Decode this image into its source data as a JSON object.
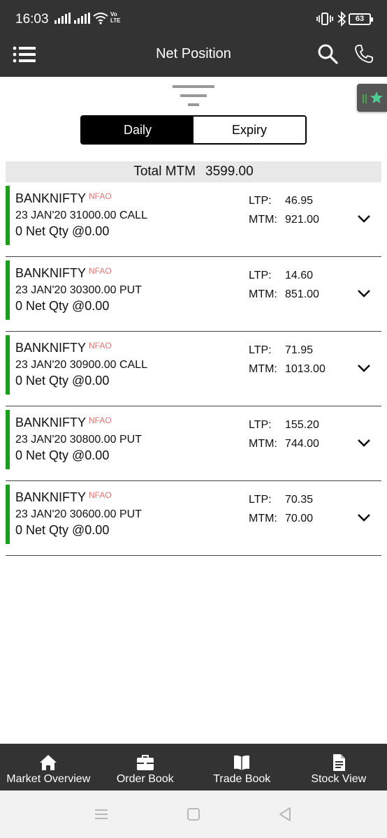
{
  "status_bar": {
    "time": "16:03",
    "volte_line1": "Vo",
    "volte_line2": "LTE",
    "battery": "63"
  },
  "app_bar": {
    "title": "Net Position"
  },
  "tabs": {
    "daily": "Daily",
    "expiry": "Expiry",
    "active": "Daily"
  },
  "total": {
    "label": "Total MTM",
    "value": "3599.00"
  },
  "positions": [
    {
      "symbol": "BANKNIFTY",
      "exchange": "NFAO",
      "contract": "23 JAN'20 31000.00 CALL",
      "qty": "0 Net Qty @0.00",
      "ltp_label": "LTP:",
      "ltp": "46.95",
      "mtm_label": "MTM:",
      "mtm": "921.00"
    },
    {
      "symbol": "BANKNIFTY",
      "exchange": "NFAO",
      "contract": "23 JAN'20 30300.00 PUT",
      "qty": "0 Net Qty @0.00",
      "ltp_label": "LTP:",
      "ltp": "14.60",
      "mtm_label": "MTM:",
      "mtm": "851.00"
    },
    {
      "symbol": "BANKNIFTY",
      "exchange": "NFAO",
      "contract": "23 JAN'20 30900.00 CALL",
      "qty": "0 Net Qty @0.00",
      "ltp_label": "LTP:",
      "ltp": "71.95",
      "mtm_label": "MTM:",
      "mtm": "1013.00"
    },
    {
      "symbol": "BANKNIFTY",
      "exchange": "NFAO",
      "contract": "23 JAN'20 30800.00 PUT",
      "qty": "0 Net Qty @0.00",
      "ltp_label": "LTP:",
      "ltp": "155.20",
      "mtm_label": "MTM:",
      "mtm": "744.00"
    },
    {
      "symbol": "BANKNIFTY",
      "exchange": "NFAO",
      "contract": "23 JAN'20 30600.00 PUT",
      "qty": "0 Net Qty @0.00",
      "ltp_label": "LTP:",
      "ltp": "70.35",
      "mtm_label": "MTM:",
      "mtm": "70.00"
    }
  ],
  "bottom_nav": [
    {
      "label": "Market Overview",
      "icon": "home-icon"
    },
    {
      "label": "Order Book",
      "icon": "briefcase-icon"
    },
    {
      "label": "Trade Book",
      "icon": "book-icon"
    },
    {
      "label": "Stock View",
      "icon": "document-icon"
    }
  ],
  "colors": {
    "bar": "#333333",
    "accent_green": "#1aa01a",
    "exchange_red": "#e57373",
    "total_bg": "#e8e8e8"
  }
}
